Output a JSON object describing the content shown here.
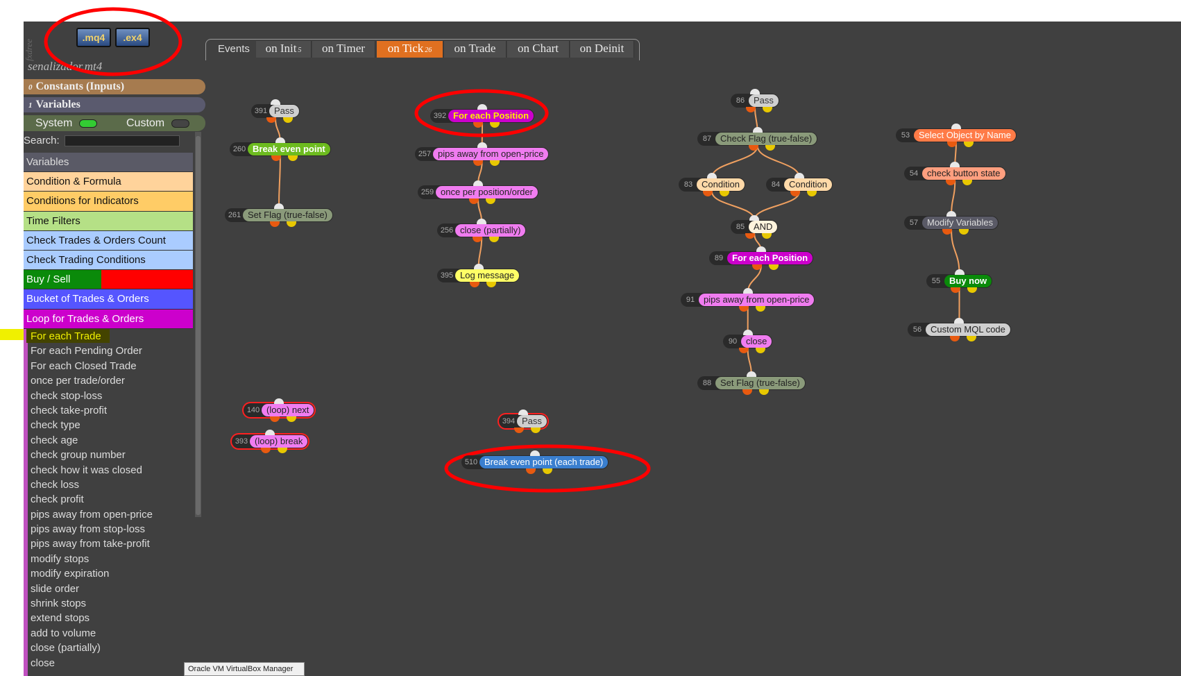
{
  "sidebar_vertical_text": "fxdree",
  "toolbar": {
    "mq4_label": ".mq4",
    "ex4_label": ".ex4"
  },
  "project_title": "senalizador.mt4",
  "sections": {
    "constants": {
      "count": "0",
      "label": "Constants (Inputs)"
    },
    "variables": {
      "count": "1",
      "label": "Variables"
    }
  },
  "toggles": {
    "system_label": "System",
    "system_on": true,
    "custom_label": "Custom",
    "custom_on": false
  },
  "search": {
    "label": "Search:",
    "value": ""
  },
  "categories": [
    {
      "label": "Variables",
      "color": "#5a5a66",
      "text": "#ddd"
    },
    {
      "label": "Condition & Formula",
      "color": "#ffd39b",
      "text": "#111"
    },
    {
      "label": "Conditions for Indicators",
      "color": "#ffcc66",
      "text": "#111"
    },
    {
      "label": "Time Filters",
      "color": "#b5e086",
      "text": "#111"
    },
    {
      "label": "Check Trades & Orders Count",
      "color": "#aaccff",
      "text": "#111"
    },
    {
      "label": "Check Trading Conditions",
      "color": "#aaccff",
      "text": "#111"
    },
    {
      "label": "Buy / Sell",
      "color": "#0a8a0a",
      "color2": "#ff0000",
      "text": "#fff"
    },
    {
      "label": "Bucket of Trades & Orders",
      "color": "#5555ff",
      "text": "#fff"
    },
    {
      "label": "Loop for Trades & Orders",
      "color": "#cc00cc",
      "text": "#fff"
    }
  ],
  "loop_items": [
    "For each Trade",
    "For each Pending Order",
    "For each Closed Trade",
    "once per trade/order",
    "check stop-loss",
    "check take-profit",
    "check type",
    "check age",
    "check group number",
    "check how it was closed",
    "check loss",
    "check profit",
    "pips away from open-price",
    "pips away from stop-loss",
    "pips away from take-profit",
    "modify stops",
    "modify expiration",
    "slide order",
    "shrink stops",
    "extend stops",
    "add to volume",
    "close (partially)",
    "close"
  ],
  "tabs": {
    "events_label": "Events",
    "items": [
      {
        "label": "on Init",
        "count": "5",
        "active": false
      },
      {
        "label": "on Timer",
        "count": "",
        "active": false
      },
      {
        "label": "on Tick",
        "count": "26",
        "active": true
      },
      {
        "label": "on Trade",
        "count": "",
        "active": false
      },
      {
        "label": "on Chart",
        "count": "",
        "active": false
      },
      {
        "label": "on Deinit",
        "count": "",
        "active": false
      }
    ]
  },
  "nodes": [
    {
      "id": "391",
      "label": "Pass",
      "color": "#cfcfcf",
      "text": "#333"
    },
    {
      "id": "260",
      "label": "Break even point",
      "color": "#6dbb1f",
      "text": "#fff"
    },
    {
      "id": "261",
      "label": "Set Flag (true-false)",
      "color": "#8a9a7a",
      "text": "#222"
    },
    {
      "id": "392",
      "label": "For each Position",
      "color": "#cc00cc",
      "text": "#ffee00"
    },
    {
      "id": "257",
      "label": "pips away from open-price",
      "color": "#f07cf0",
      "text": "#222"
    },
    {
      "id": "259",
      "label": "once per position/order",
      "color": "#f07cf0",
      "text": "#222"
    },
    {
      "id": "256",
      "label": "close (partially)",
      "color": "#f07cf0",
      "text": "#222"
    },
    {
      "id": "395",
      "label": "Log message",
      "color": "#ffff66",
      "text": "#222"
    },
    {
      "id": "86",
      "label": "Pass",
      "color": "#cfcfcf",
      "text": "#333"
    },
    {
      "id": "87",
      "label": "Check Flag (true-false)",
      "color": "#8a9a7a",
      "text": "#222"
    },
    {
      "id": "83",
      "label": "Condition",
      "color": "#ffd9a8",
      "text": "#222"
    },
    {
      "id": "84",
      "label": "Condition",
      "color": "#ffd9a8",
      "text": "#222"
    },
    {
      "id": "85",
      "label": "AND",
      "color": "#fff4dd",
      "text": "#222"
    },
    {
      "id": "89",
      "label": "For each Position",
      "color": "#cc00cc",
      "text": "#fff"
    },
    {
      "id": "91",
      "label": "pips away from open-price",
      "color": "#f07cf0",
      "text": "#222"
    },
    {
      "id": "90",
      "label": "close",
      "color": "#f07cf0",
      "text": "#222"
    },
    {
      "id": "88",
      "label": "Set Flag (true-false)",
      "color": "#8a9a7a",
      "text": "#222"
    },
    {
      "id": "53",
      "label": "Select Object by Name",
      "color": "#ff7b47",
      "text": "#fff"
    },
    {
      "id": "54",
      "label": "check button state",
      "color": "#ff9f7f",
      "text": "#222"
    },
    {
      "id": "57",
      "label": "Modify Variables",
      "color": "#5a5a66",
      "text": "#ddd"
    },
    {
      "id": "55",
      "label": "Buy now",
      "color": "#0a8a0a",
      "text": "#fff"
    },
    {
      "id": "56",
      "label": "Custom MQL code",
      "color": "#cfcfcf",
      "text": "#222"
    },
    {
      "id": "140",
      "label": "(loop) next",
      "color": "#f07cf0",
      "text": "#222"
    },
    {
      "id": "393",
      "label": "(loop) break",
      "color": "#f07cf0",
      "text": "#222"
    },
    {
      "id": "394",
      "label": "Pass",
      "color": "#cfcfcf",
      "text": "#333"
    },
    {
      "id": "510",
      "label": "Break even point (each trade)",
      "color": "#3a7fcf",
      "text": "#fff"
    }
  ],
  "taskbar_tooltip": "Oracle VM VirtualBox Manager"
}
